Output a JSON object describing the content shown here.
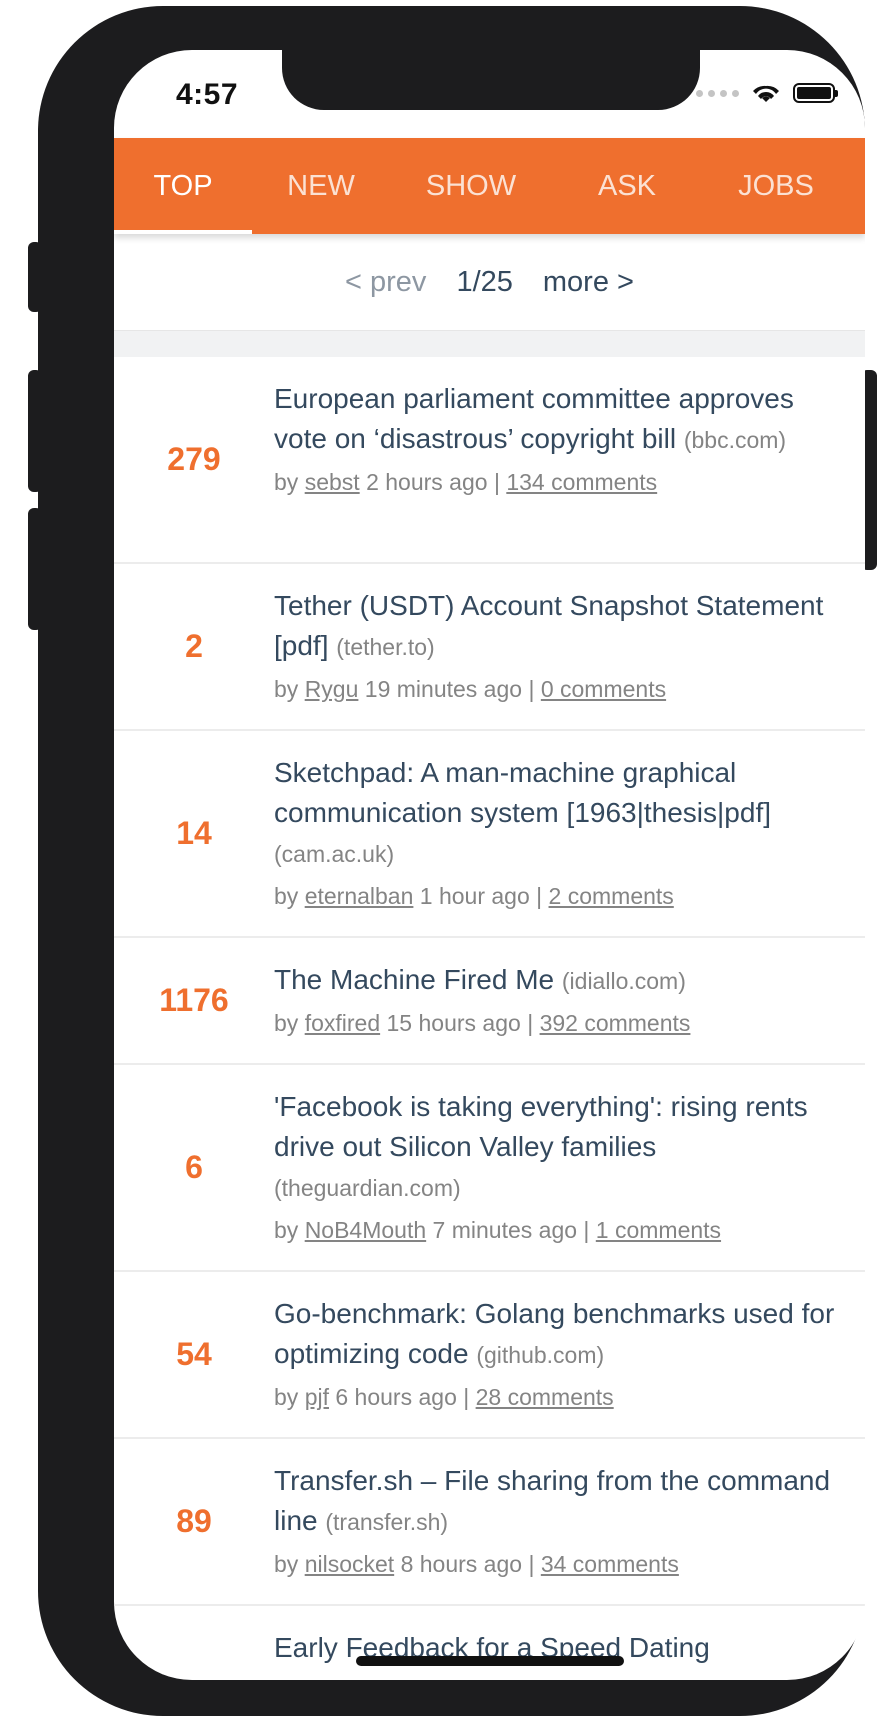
{
  "status_bar": {
    "time": "4:57"
  },
  "tabs": [
    {
      "label": "TOP",
      "active": true
    },
    {
      "label": "NEW",
      "active": false
    },
    {
      "label": "SHOW",
      "active": false
    },
    {
      "label": "ASK",
      "active": false
    },
    {
      "label": "JOBS",
      "active": false
    }
  ],
  "pager": {
    "prev": "< prev",
    "page": "1/25",
    "more": "more >"
  },
  "stories": [
    {
      "score": "279",
      "title": "European parliament committee approves vote on ‘disastrous’ copyright bill",
      "host": "(bbc.com)",
      "by": "by",
      "user": "sebst",
      "age": "2 hours ago",
      "sep": "|",
      "comments": "134 comments"
    },
    {
      "score": "2",
      "title": "Tether (USDT) Account Snapshot Statement [pdf]",
      "host": "(tether.to)",
      "by": "by",
      "user": "Rygu",
      "age": "19 minutes ago",
      "sep": "|",
      "comments": "0 comments"
    },
    {
      "score": "14",
      "title": "Sketchpad: A man-machine graphical communication system [1963|thesis|pdf]",
      "host": "(cam.ac.uk)",
      "by": "by",
      "user": "eternalban",
      "age": "1 hour ago",
      "sep": "|",
      "comments": "2 comments"
    },
    {
      "score": "1176",
      "title": "The Machine Fired Me",
      "host": "(idiallo.com)",
      "by": "by",
      "user": "foxfired",
      "age": "15 hours ago",
      "sep": "|",
      "comments": "392 comments"
    },
    {
      "score": "6",
      "title": "'Facebook is taking everything': rising rents drive out Silicon Valley families",
      "host": "(theguardian.com)",
      "by": "by",
      "user": "NoB4Mouth",
      "age": "7 minutes ago",
      "sep": "|",
      "comments": "1 comments"
    },
    {
      "score": "54",
      "title": "Go-benchmark: Golang benchmarks used for optimizing code",
      "host": "(github.com)",
      "by": "by",
      "user": "pjf",
      "age": "6 hours ago",
      "sep": "|",
      "comments": "28 comments"
    },
    {
      "score": "89",
      "title": "Transfer.sh – File sharing from the command line",
      "host": "(transfer.sh)",
      "by": "by",
      "user": "nilsocket",
      "age": "8 hours ago",
      "sep": "|",
      "comments": "34 comments"
    },
    {
      "score": "",
      "title": "Early Feedback for a Speed Dating",
      "host": "",
      "by": "",
      "user": "",
      "age": "",
      "sep": "",
      "comments": ""
    }
  ]
}
